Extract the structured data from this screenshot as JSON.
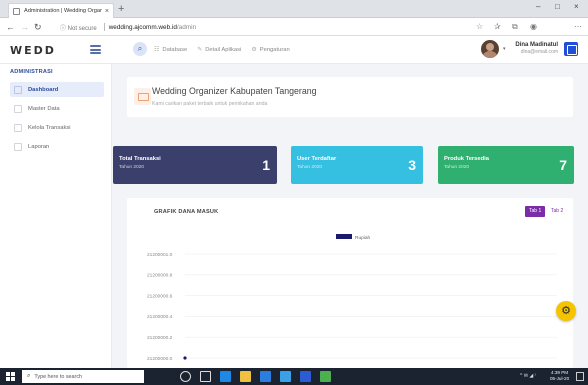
{
  "browser": {
    "tab_title": "Administration | Wedding Organi",
    "tab_close": "×",
    "new_tab": "+",
    "window_controls": [
      "–",
      "□",
      "×"
    ],
    "nav": {
      "back": "←",
      "forward": "→",
      "reload": "↻"
    },
    "url_secure": "ⓘ Not secure",
    "url_host": "wedding.ajcomm.web.id",
    "url_path": "/admin",
    "icons": [
      "star-icon",
      "favorites-icon",
      "collections-icon",
      "profile-icon",
      "more-icon"
    ]
  },
  "header": {
    "brand": "WEDD",
    "nav_items": [
      {
        "label": "Database",
        "icon": "database-icon"
      },
      {
        "label": "Detail Aplikasi",
        "icon": "edit-icon"
      },
      {
        "label": "Pengaturan",
        "icon": "settings-icon"
      }
    ],
    "user_name": "Dina Madinatul",
    "user_email": "dina@email.com"
  },
  "sidebar": {
    "heading": "ADMINISTRASI",
    "items": [
      {
        "label": "Dashboard",
        "active": true
      },
      {
        "label": "Master Data",
        "active": false
      },
      {
        "label": "Kelola Transaksi",
        "active": false
      },
      {
        "label": "Laporan",
        "active": false
      }
    ]
  },
  "welcome": {
    "title": "Wedding Organizer Kabupaten Tangerang",
    "subtitle": "Kami carikan paket terbaik untuk pernikahan anda"
  },
  "stats": [
    {
      "title": "Total Transaksi",
      "subtitle": "Tahun 2020",
      "value": "1",
      "color": "#3a3f6b"
    },
    {
      "title": "User Terdaftar",
      "subtitle": "Tahun 2020",
      "value": "3",
      "color": "#35bfe0"
    },
    {
      "title": "Produk Tersedia",
      "subtitle": "Tahun 2020",
      "value": "7",
      "color": "#2fb070"
    }
  ],
  "chart_card": {
    "title": "GRAFIK DANA MASUK",
    "tabs": [
      "Tab 1",
      "Tab 2"
    ]
  },
  "chart_data": {
    "type": "line",
    "title": "",
    "legend": [
      "Rupiah"
    ],
    "legend_position": "top-center",
    "series": [
      {
        "name": "Rupiah",
        "color": "#1a1a6e",
        "points": [
          {
            "x": 0,
            "y": 21200000
          }
        ]
      }
    ],
    "y_ticks": [
      "21200001.0",
      "21200000.8",
      "21200000.6",
      "21200000.4",
      "21200000.2",
      "21200000.0"
    ],
    "ylim": [
      21200000.0,
      21200001.0
    ],
    "grid": true
  },
  "taskbar": {
    "search_placeholder": "Type here to search",
    "tray": "^ ✉ ◢ ⁾",
    "time": "4:39 PM",
    "date": "05-Jul-20"
  }
}
